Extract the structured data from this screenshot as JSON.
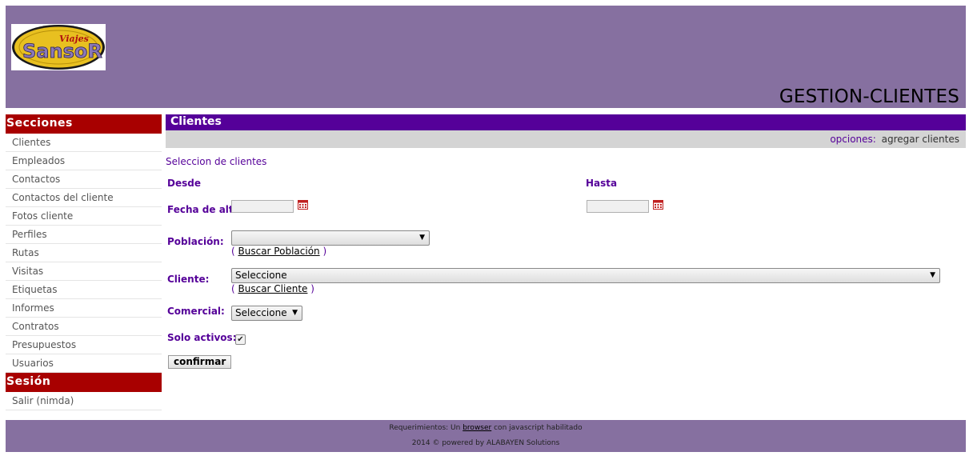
{
  "header": {
    "logo_text": "Viajes SansoR",
    "app_title": "GESTION-CLIENTES"
  },
  "sidebar": {
    "sections_title": "Secciones",
    "items": [
      {
        "label": "Clientes"
      },
      {
        "label": "Empleados"
      },
      {
        "label": "Contactos"
      },
      {
        "label": "Contactos del cliente"
      },
      {
        "label": "Fotos cliente"
      },
      {
        "label": "Perfiles"
      },
      {
        "label": "Rutas"
      },
      {
        "label": "Visitas"
      },
      {
        "label": "Etiquetas"
      },
      {
        "label": "Informes"
      },
      {
        "label": "Contratos"
      },
      {
        "label": "Presupuestos"
      },
      {
        "label": "Usuarios"
      }
    ],
    "session_title": "Sesión",
    "session_items": [
      {
        "label": "Salir (nimda)"
      }
    ]
  },
  "main": {
    "title": "Clientes",
    "options_label": "opciones:",
    "options_link": "agregar clientes",
    "subtitle": "Seleccion de clientes",
    "desde_label": "Desde",
    "hasta_label": "Hasta",
    "fecha_label": "Fecha de alta",
    "fecha_desde_value": "",
    "fecha_hasta_value": "",
    "poblacion_label": "Población:",
    "poblacion_value": "",
    "buscar_poblacion_open": "(",
    "buscar_poblacion": "Buscar Población",
    "buscar_poblacion_close": ")",
    "cliente_label": "Cliente:",
    "cliente_value": "Seleccione",
    "buscar_cliente_open": "(",
    "buscar_cliente": "Buscar Cliente",
    "buscar_cliente_close": ")",
    "comercial_label": "Comercial:",
    "comercial_value": "Seleccione",
    "solo_activos_label": "Solo activos:",
    "solo_activos_checked": true,
    "confirm_label": "confirmar"
  },
  "footer": {
    "req_prefix": "Requerimientos: Un",
    "req_link": "browser",
    "req_suffix": "con javascript habilitado",
    "powered": "2014 © powered by ALABAYEN Solutions"
  },
  "colors": {
    "header_bg": "#8670a0",
    "section_red": "#a80000",
    "title_purple": "#550099"
  }
}
